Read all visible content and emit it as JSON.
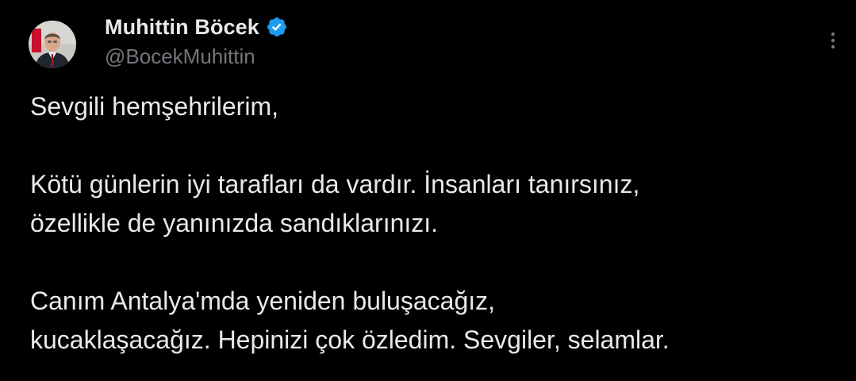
{
  "tweet": {
    "author": {
      "display_name": "Muhittin Böcek",
      "handle": "@BocekMuhittin",
      "verified": true,
      "avatar_icon": "profile-photo"
    },
    "more_icon": "more-options-icon",
    "text": {
      "greeting": "Sevgili hemşehrilerim,",
      "paragraph_2_line_1": "Kötü günlerin iyi tarafları da vardır. İnsanları tanırsınız,",
      "paragraph_2_line_2": "özellikle de yanınızda sandıklarınızı.",
      "paragraph_3_line_1": "Canım Antalya'mda yeniden buluşacağız,",
      "paragraph_3_line_2": "kucaklaşacağız. Hepinizi çok özledim. Sevgiler, selamlar."
    }
  },
  "colors": {
    "background": "#000000",
    "primary_text": "#e7e9ea",
    "secondary_text": "#71767b",
    "verified_blue": "#1d9bf0"
  }
}
